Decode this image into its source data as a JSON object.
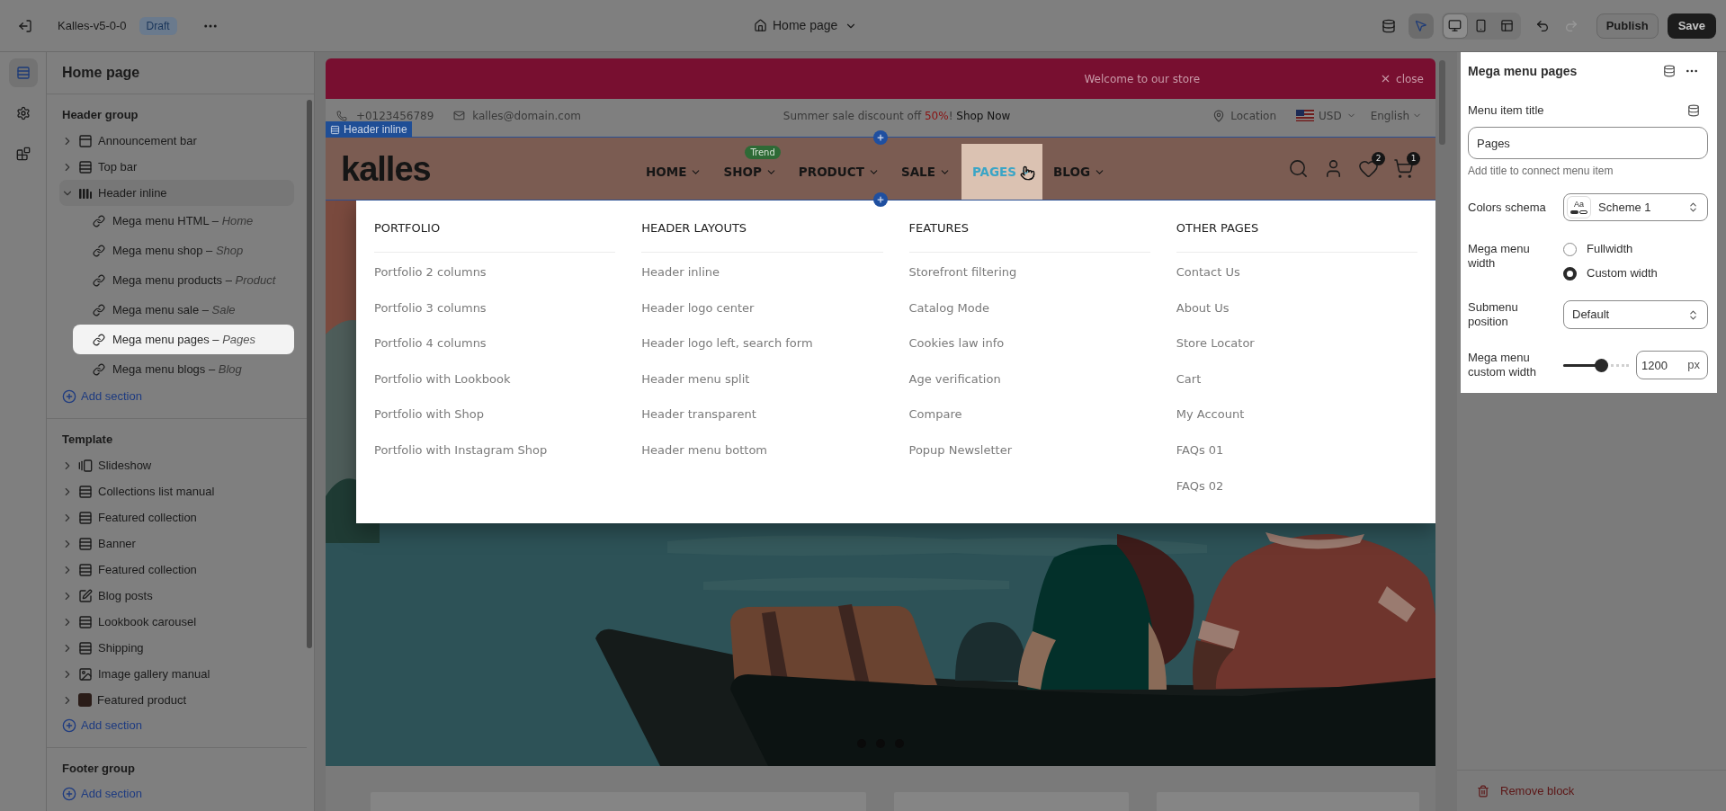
{
  "topbar": {
    "store": "Kalles-v5-0-0",
    "status": "Draft",
    "page": "Home page",
    "inspect_on": true,
    "devices": [
      {
        "selected": true
      },
      {
        "selected": false
      },
      {
        "selected": false
      }
    ],
    "undo_disabled": false,
    "redo_disabled": true,
    "publish": "Publish",
    "save": "Save"
  },
  "rail": [
    {
      "selected": true
    },
    {
      "selected": false
    },
    {
      "selected": false
    }
  ],
  "sidebar": {
    "title": "Home page",
    "groups": [
      {
        "title": "Header group",
        "add": "Add section",
        "items": [
          {
            "kind": "announcement",
            "label": "Announcement bar",
            "expanded": false
          },
          {
            "kind": "section",
            "label": "Top bar",
            "expanded": false
          },
          {
            "kind": "header",
            "label": "Header inline",
            "expanded": true,
            "children": [
              {
                "label": "Mega menu HTML – *Home*",
                "selected": false
              },
              {
                "label": "Mega menu shop – *Shop*",
                "selected": false
              },
              {
                "label": "Mega menu products – *Product*",
                "selected": false
              },
              {
                "label": "Mega menu sale – *Sale*",
                "selected": false
              },
              {
                "label": "Mega menu pages – *Pages*",
                "selected": true
              },
              {
                "label": "Mega menu blogs – *Blog*",
                "selected": false
              }
            ]
          }
        ]
      },
      {
        "title": "Template",
        "add": "Add section",
        "items": [
          {
            "kind": "slideshow",
            "label": "Slideshow",
            "expanded": false
          },
          {
            "kind": "section",
            "label": "Collections list manual",
            "expanded": false
          },
          {
            "kind": "section",
            "label": "Featured collection",
            "expanded": false
          },
          {
            "kind": "section",
            "label": "Banner",
            "expanded": false
          },
          {
            "kind": "section",
            "label": "Featured collection",
            "expanded": false
          },
          {
            "kind": "blog",
            "label": "Blog posts",
            "expanded": false
          },
          {
            "kind": "section",
            "label": "Lookbook carousel",
            "expanded": false
          },
          {
            "kind": "section",
            "label": "Shipping",
            "expanded": false
          },
          {
            "kind": "gallery",
            "label": "Image gallery manual",
            "expanded": false
          },
          {
            "kind": "product",
            "label": "Featured product",
            "expanded": false
          }
        ]
      },
      {
        "title": "Footer group",
        "add": "Add section"
      }
    ]
  },
  "preview": {
    "announcement": {
      "text": "Welcome to our store",
      "close": "close"
    },
    "topbar": {
      "phone": "+0123456789",
      "email": "kalles@domain.com",
      "promo": "Summer sale discount off",
      "promo_highlight": "50%",
      "promo_end": "!",
      "promo_link": "Shop Now",
      "location": "Location",
      "currency": "USD",
      "language": "English"
    },
    "section_tag": "Header inline",
    "header": {
      "logo": "kalles",
      "wishlist_count": "2",
      "cart_count": "1",
      "nav": [
        {
          "label": "HOME",
          "selected": false
        },
        {
          "label": "SHOP",
          "badge": "Trend",
          "selected": false
        },
        {
          "label": "PRODUCT",
          "selected": false
        },
        {
          "label": "SALE",
          "selected": false
        },
        {
          "label": "PAGES",
          "selected": true
        },
        {
          "label": "BLOG",
          "selected": false
        }
      ]
    },
    "mega_menu": {
      "columns": [
        {
          "title": "PORTFOLIO",
          "links": [
            "Portfolio 2 columns",
            "Portfolio 3 columns",
            "Portfolio 4 columns",
            "Portfolio with Lookbook",
            "Portfolio with Shop",
            "Portfolio with Instagram Shop"
          ]
        },
        {
          "title": "HEADER LAYOUTS",
          "links": [
            "Header inline",
            "Header logo center",
            "Header logo left, search form",
            "Header menu split",
            "Header transparent",
            "Header menu bottom"
          ]
        },
        {
          "title": "FEATURES",
          "links": [
            "Storefront filtering",
            "Catalog Mode",
            "Cookies law info",
            "Age verification",
            "Compare",
            "Popup Newsletter"
          ]
        },
        {
          "title": "OTHER PAGES",
          "links": [
            "Contact Us",
            "About Us",
            "Store Locator",
            "Cart",
            "My Account",
            "FAQs 01",
            "FAQs 02"
          ]
        }
      ]
    }
  },
  "inspector": {
    "title": "Mega menu pages",
    "menu_item_title": {
      "label": "Menu item title",
      "value": "Pages",
      "hint": "Add title to connect menu item"
    },
    "color_scheme": {
      "label": "Colors schema",
      "swatch": "Aa",
      "value": "Scheme 1"
    },
    "menu_width": {
      "label": "Mega menu width",
      "options": [
        {
          "label": "Fullwidth",
          "selected": false
        },
        {
          "label": "Custom width",
          "selected": true
        }
      ]
    },
    "submenu_position": {
      "label": "Submenu position",
      "value": "Default"
    },
    "custom_width": {
      "label": "Mega menu custom width",
      "level": 0.58,
      "value": "1200",
      "unit": "px"
    },
    "remove": "Remove block"
  }
}
